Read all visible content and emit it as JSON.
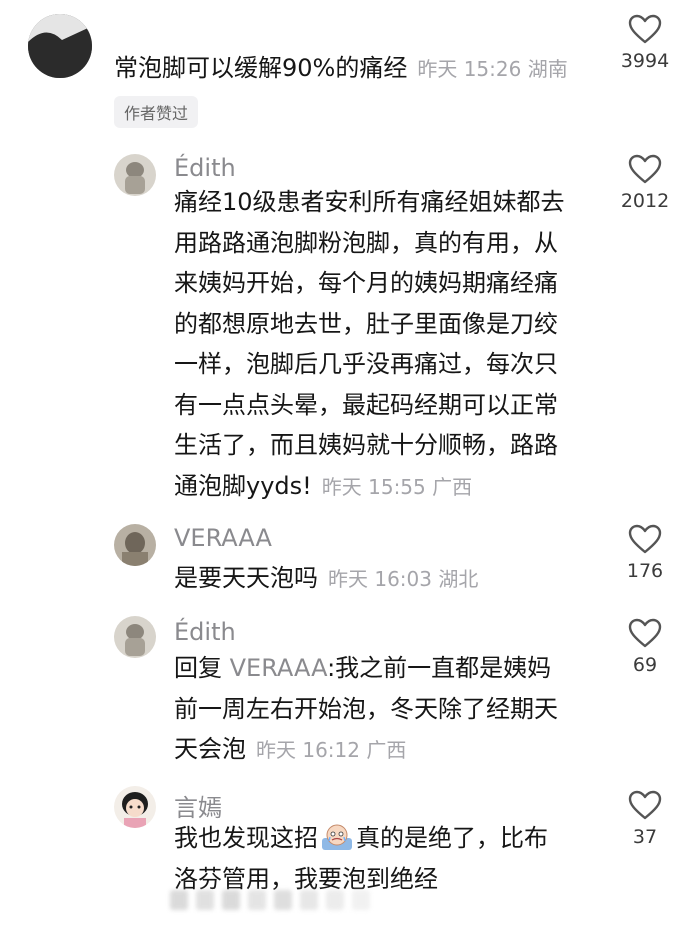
{
  "comments": [
    {
      "text": "常泡脚可以缓解90%的痛经",
      "time": "昨天 15:26 湖南",
      "likes": "3994",
      "badge": "作者赞过"
    },
    {
      "username": "Édith",
      "lines": [
        "痛经10级患者安利所有痛经姐妹都去",
        "用路路通泡脚粉泡脚，真的有用，从",
        "来姨妈开始，每个月的姨妈期痛经痛",
        "的都想原地去世，肚子里面像是刀绞",
        "一样，泡脚后几乎没再痛过，每次只",
        "有一点点头晕，最起码经期可以正常",
        "生活了，而且姨妈就十分顺畅，路路",
        "通泡脚yyds!"
      ],
      "time": "昨天 15:55 广西",
      "likes": "2012"
    },
    {
      "username": "VERAAA",
      "text": "是要天天泡吗",
      "time": "昨天 16:03 湖北",
      "likes": "176"
    },
    {
      "username": "Édith",
      "reply_prefix": "回复 ",
      "reply_to": "VERAAA",
      "lines": [
        ":我之前一直都是姨妈",
        "前一周左右开始泡，冬天除了经期天",
        "天会泡"
      ],
      "time": "昨天 16:12 广西",
      "likes": "69"
    },
    {
      "username": "言嫣",
      "lines": [
        "我也发现这招",
        "真的是绝了，比布",
        "洛芬管用，我要泡到绝经"
      ],
      "likes": "37"
    }
  ],
  "icons": {
    "like": "heart-outline-icon",
    "sticker": "crying-face-sticker-icon"
  }
}
